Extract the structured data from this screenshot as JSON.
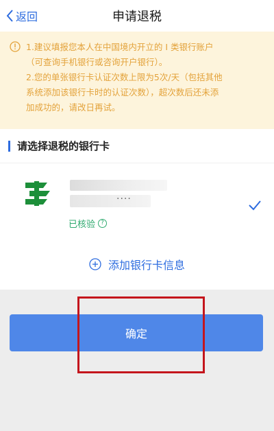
{
  "navbar": {
    "back_label": "返回",
    "title": "申请退税"
  },
  "notice": {
    "icon": "info-icon",
    "lines": [
      "1.建议填报您本人在中国境内开立的 I 类银行账户",
      "（可查询手机银行或咨询开户银行）。",
      "2.您的单张银行卡认证次数上限为5次/天（包括其他",
      "系统添加该银行卡时的认证次数），超次数后还未添",
      "加成功的，请改日再试。"
    ],
    "color": "#e3a23a",
    "background": "#fdf4dc"
  },
  "section": {
    "title": "请选择退税的银行卡"
  },
  "bank_card": {
    "logo_icon": "postal-bank-logo-icon",
    "number_masked": "····",
    "status": "已核验",
    "help_icon": "question-icon",
    "selected": true
  },
  "add_card": {
    "label": "添加银行卡信息"
  },
  "confirm_button": {
    "label": "确定"
  },
  "colors": {
    "accent": "#2d6cdf",
    "button": "#4f87e8",
    "verified": "#2faa6f",
    "highlight": "#c4151c"
  }
}
